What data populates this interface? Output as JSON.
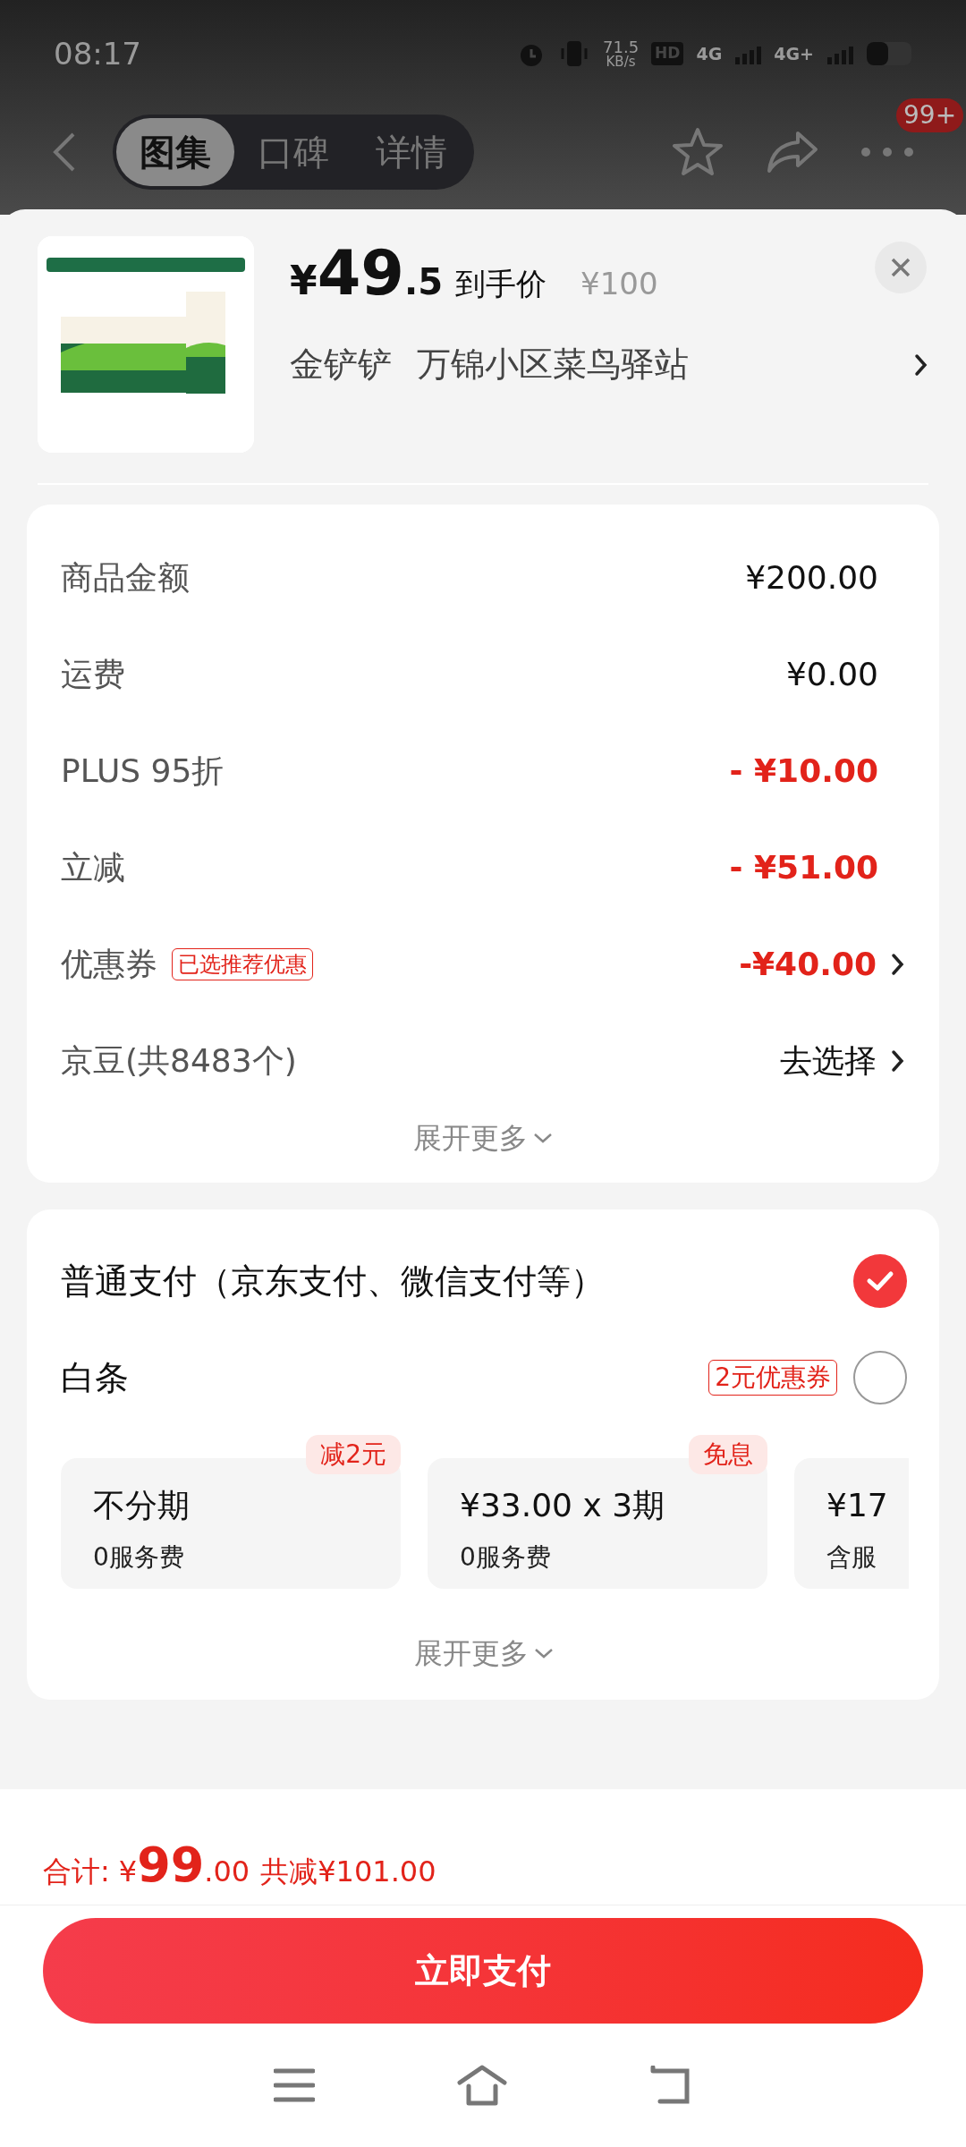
{
  "status_bar": {
    "time": "08:17",
    "speed": "71.5",
    "speed_unit": "KB/s",
    "hd": "HD",
    "sim1": "4G",
    "sim2": "4G+"
  },
  "header": {
    "tabs": [
      {
        "label": "图集",
        "selected": true
      },
      {
        "label": "口碑",
        "selected": false
      },
      {
        "label": "详情",
        "selected": false
      }
    ],
    "badge": "99+"
  },
  "product": {
    "currency": "¥",
    "price_int": "49",
    "price_dec": ".5",
    "price_label": "到手价",
    "original_price": "¥100",
    "buyer": "金铲铲",
    "address": "万锦小区菜鸟驿站"
  },
  "price_rows": [
    {
      "label": "商品金额",
      "value": "¥200.00",
      "discount": false,
      "chevron": false
    },
    {
      "label": "运费",
      "value": "¥0.00",
      "discount": false,
      "chevron": false
    },
    {
      "label": "PLUS 95折",
      "value": "- ¥10.00",
      "discount": true,
      "chevron": false
    },
    {
      "label": "立减",
      "value": "- ¥51.00",
      "discount": true,
      "chevron": false
    },
    {
      "label": "优惠券",
      "tag": "已选推荐优惠",
      "value": "-¥40.00",
      "discount": true,
      "chevron": true
    },
    {
      "label": "京豆(共8483个)",
      "value": "去选择",
      "discount": false,
      "chevron": true
    }
  ],
  "price_expand": "展开更多",
  "payment_methods": [
    {
      "label": "普通支付（京东支付、微信支付等）",
      "selected": true
    },
    {
      "label": "白条",
      "tag": "2元优惠券",
      "selected": false
    }
  ],
  "installments": [
    {
      "tag": "减2元",
      "title": "不分期",
      "sub": "0服务费"
    },
    {
      "tag": "免息",
      "title": "¥33.00 x 3期",
      "sub": "0服务费"
    },
    {
      "title": "¥17",
      "sub": "含服"
    }
  ],
  "payment_expand": "展开更多",
  "total": {
    "label": "合计:",
    "currency": "¥",
    "int": "99",
    "dec": ".00",
    "saving": "共减¥101.00"
  },
  "pay_button": "立即支付"
}
